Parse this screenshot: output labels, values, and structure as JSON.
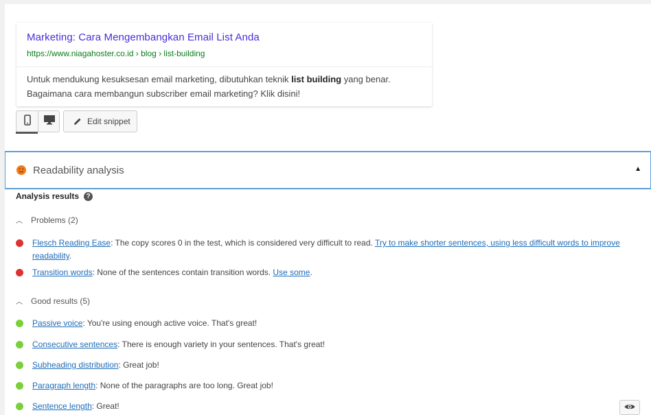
{
  "snippet": {
    "title": "Marketing: Cara Mengembangkan Email List Anda",
    "url": "https://www.niagahoster.co.id › blog › list-building",
    "desc_before": "Untuk mendukung kesuksesan email marketing, dibutuhkan teknik ",
    "desc_bold": "list building",
    "desc_after": " yang benar. Bagaimana cara membangun subscriber email marketing? Klik disini!"
  },
  "toolbar": {
    "mobile_icon": "mobile-icon",
    "desktop_icon": "desktop-icon",
    "edit_label": "Edit snippet"
  },
  "readability": {
    "title": "Readability analysis",
    "status_color": "#ee7c1b",
    "analysis_title": "Analysis results",
    "problems_label": "Problems (2)",
    "good_label": "Good results (5)",
    "problems": [
      {
        "link": "Flesch Reading Ease",
        "text": ": The copy scores 0 in the test, which is considered very difficult to read. ",
        "action": "Try to make shorter sentences, using less difficult words to improve readability",
        "after": "."
      },
      {
        "link": "Transition words",
        "text": ": None of the sentences contain transition words. ",
        "action": "Use some",
        "after": "."
      }
    ],
    "good": [
      {
        "link": "Passive voice",
        "text": ": You're using enough active voice. That's great!"
      },
      {
        "link": "Consecutive sentences",
        "text": ": There is enough variety in your sentences. That's great!"
      },
      {
        "link": "Subheading distribution",
        "text": ": Great job!"
      },
      {
        "link": "Paragraph length",
        "text": ": None of the paragraphs are too long. Great job!"
      },
      {
        "link": "Sentence length",
        "text": ": Great!"
      }
    ]
  },
  "colors": {
    "problem": "#dc3232",
    "good": "#7ad03a",
    "link": "#1e6bb8",
    "accent_border": "#5b9dd9"
  }
}
